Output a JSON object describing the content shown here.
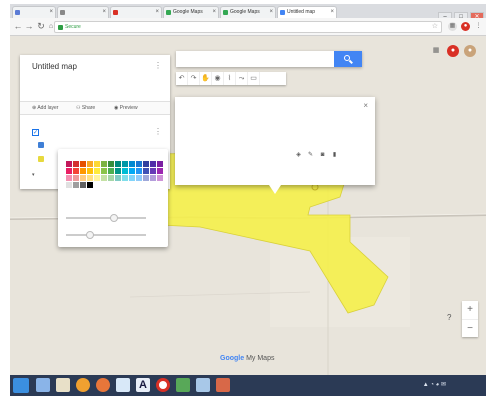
{
  "browser": {
    "tabs": [
      {
        "label": "",
        "active": false,
        "color": "#5b7bd5"
      },
      {
        "label": "",
        "active": false,
        "color": "#888888"
      },
      {
        "label": "",
        "active": false,
        "color": "#d93025"
      },
      {
        "label": "Google Maps",
        "active": false,
        "color": "#34a853"
      },
      {
        "label": "Google Maps",
        "active": false,
        "color": "#34a853"
      },
      {
        "label": "Untitled map",
        "active": true,
        "color": "#4285f4"
      }
    ],
    "secure_label": "Secure",
    "url": "",
    "window_controls": [
      "–",
      "□",
      "✕"
    ]
  },
  "panel": {
    "title": "Untitled map",
    "description": "",
    "status": "",
    "actions": {
      "add_layer": "Add layer",
      "share": "Share",
      "preview": "Preview"
    },
    "layer": {
      "name": "",
      "features": [
        {
          "label": "",
          "color": "#3f7fd6"
        },
        {
          "label": "",
          "color": "#e7d93e"
        }
      ]
    },
    "base_map_label": ""
  },
  "color_picker": {
    "title": "",
    "swatches": [
      "#c2185b",
      "#d32f2f",
      "#e65100",
      "#f9a825",
      "#fdd835",
      "#7cb342",
      "#388e3c",
      "#00897b",
      "#0097a7",
      "#0288d1",
      "#1976d2",
      "#303f9f",
      "#512da8",
      "#7b1fa2",
      "#e91e63",
      "#f44336",
      "#ff9800",
      "#ffc107",
      "#ffeb3b",
      "#8bc34a",
      "#4caf50",
      "#009688",
      "#00bcd4",
      "#03a9f4",
      "#2196f3",
      "#3f51b5",
      "#673ab7",
      "#9c27b0",
      "#f48fb1",
      "#ef9a9a",
      "#ffcc80",
      "#ffe082",
      "#fff59d",
      "#c5e1a5",
      "#a5d6a7",
      "#80cbc4",
      "#80deea",
      "#81d4fa",
      "#90caf9",
      "#9fa8da",
      "#b39ddb",
      "#ce93d8",
      "#e0e0e0",
      "#9e9e9e",
      "#616161",
      "#000000"
    ],
    "opacity_label": "",
    "border_label": "",
    "opacity_value": 0.6,
    "border_value": 0.3
  },
  "info": {
    "title": "",
    "line1": "",
    "line2": "",
    "actions_text": ""
  },
  "search": {
    "placeholder": ""
  },
  "map": {
    "logo_brand": "Google",
    "logo_product": "My Maps",
    "credits": "",
    "road_label_left": "",
    "road_label_right": "",
    "polygon_color": "#f5ef4a",
    "water_color": "#8fc3ea"
  },
  "taskbar": {
    "time": "",
    "date": ""
  }
}
